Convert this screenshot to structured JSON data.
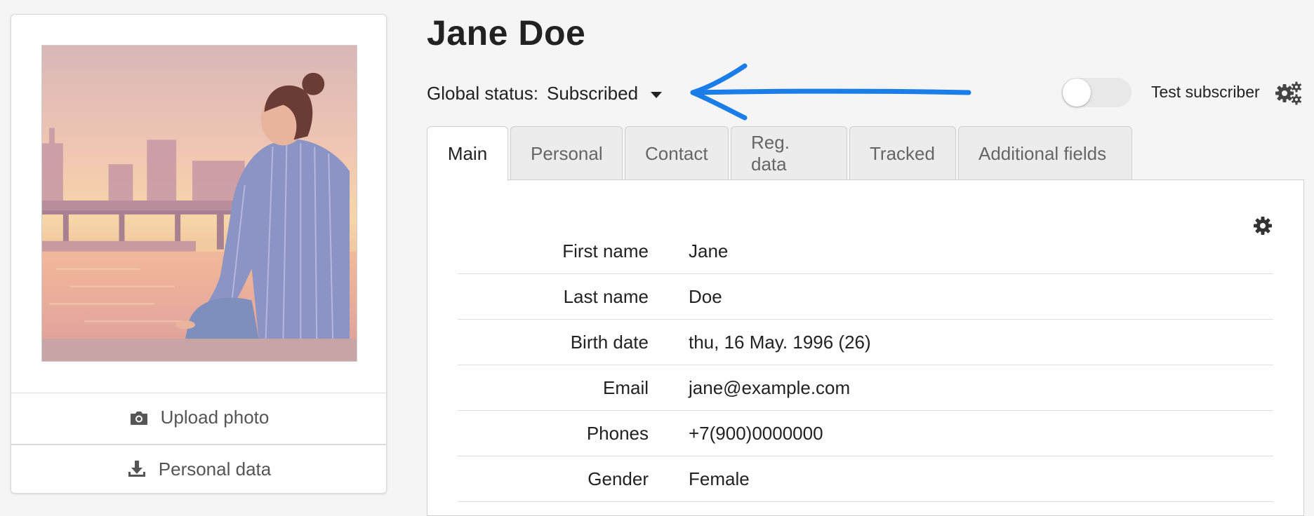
{
  "profile": {
    "name": "Jane Doe",
    "upload_label": "Upload photo",
    "personal_data_label": "Personal data"
  },
  "status": {
    "label": "Global status:",
    "value": "Subscribed"
  },
  "test_subscriber": {
    "label": "Test subscriber",
    "enabled": false
  },
  "tabs": [
    {
      "label": "Main",
      "active": true
    },
    {
      "label": "Personal",
      "active": false
    },
    {
      "label": "Contact",
      "active": false
    },
    {
      "label": "Reg. data",
      "active": false
    },
    {
      "label": "Tracked",
      "active": false
    },
    {
      "label": "Additional fields",
      "active": false
    }
  ],
  "fields": [
    {
      "label": "First name",
      "value": "Jane"
    },
    {
      "label": "Last name",
      "value": "Doe"
    },
    {
      "label": "Birth date",
      "value": "thu, 16 May. 1996 (26)"
    },
    {
      "label": "Email",
      "value": "jane@example.com"
    },
    {
      "label": "Phones",
      "value": "+7(900)0000000"
    },
    {
      "label": "Gender",
      "value": "Female"
    }
  ],
  "colors": {
    "annotation_arrow": "#1a7de8",
    "icon": "#555555"
  }
}
